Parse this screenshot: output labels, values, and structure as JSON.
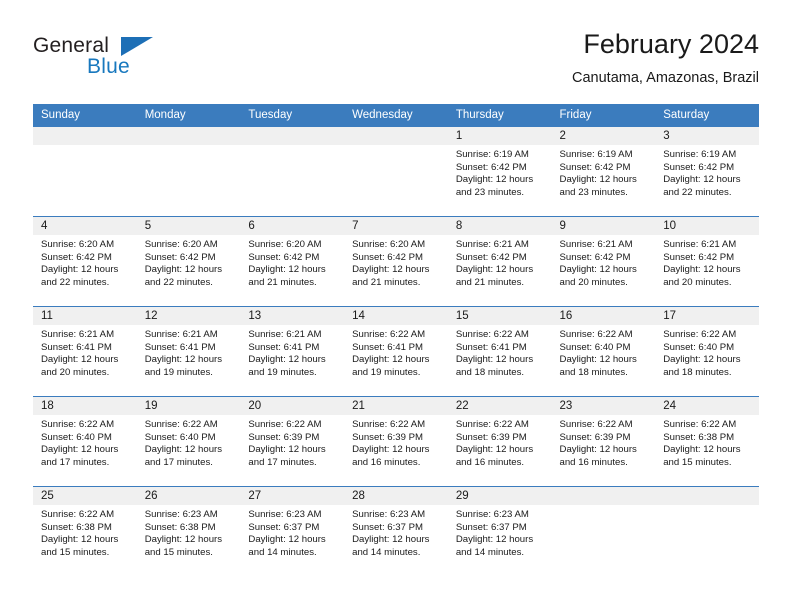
{
  "brand": {
    "name_part1": "General",
    "name_part2": "Blue",
    "triangle_color": "#1d6fb6",
    "blue_color": "#1878be"
  },
  "header": {
    "title": "February 2024",
    "location": "Canutama, Amazonas, Brazil"
  },
  "theme": {
    "header_row_bg": "#3b7cbe",
    "daynum_band_bg": "#f0f0f0",
    "grid_line": "#3b7cbe",
    "text": "#1a1a1a"
  },
  "weekday_headers": [
    "Sunday",
    "Monday",
    "Tuesday",
    "Wednesday",
    "Thursday",
    "Friday",
    "Saturday"
  ],
  "weeks": [
    [
      {
        "day": "",
        "sunrise": "",
        "sunset": "",
        "daylight_line1": "",
        "daylight_line2": ""
      },
      {
        "day": "",
        "sunrise": "",
        "sunset": "",
        "daylight_line1": "",
        "daylight_line2": ""
      },
      {
        "day": "",
        "sunrise": "",
        "sunset": "",
        "daylight_line1": "",
        "daylight_line2": ""
      },
      {
        "day": "",
        "sunrise": "",
        "sunset": "",
        "daylight_line1": "",
        "daylight_line2": ""
      },
      {
        "day": "1",
        "sunrise": "Sunrise: 6:19 AM",
        "sunset": "Sunset: 6:42 PM",
        "daylight_line1": "Daylight: 12 hours",
        "daylight_line2": "and 23 minutes."
      },
      {
        "day": "2",
        "sunrise": "Sunrise: 6:19 AM",
        "sunset": "Sunset: 6:42 PM",
        "daylight_line1": "Daylight: 12 hours",
        "daylight_line2": "and 23 minutes."
      },
      {
        "day": "3",
        "sunrise": "Sunrise: 6:19 AM",
        "sunset": "Sunset: 6:42 PM",
        "daylight_line1": "Daylight: 12 hours",
        "daylight_line2": "and 22 minutes."
      }
    ],
    [
      {
        "day": "4",
        "sunrise": "Sunrise: 6:20 AM",
        "sunset": "Sunset: 6:42 PM",
        "daylight_line1": "Daylight: 12 hours",
        "daylight_line2": "and 22 minutes."
      },
      {
        "day": "5",
        "sunrise": "Sunrise: 6:20 AM",
        "sunset": "Sunset: 6:42 PM",
        "daylight_line1": "Daylight: 12 hours",
        "daylight_line2": "and 22 minutes."
      },
      {
        "day": "6",
        "sunrise": "Sunrise: 6:20 AM",
        "sunset": "Sunset: 6:42 PM",
        "daylight_line1": "Daylight: 12 hours",
        "daylight_line2": "and 21 minutes."
      },
      {
        "day": "7",
        "sunrise": "Sunrise: 6:20 AM",
        "sunset": "Sunset: 6:42 PM",
        "daylight_line1": "Daylight: 12 hours",
        "daylight_line2": "and 21 minutes."
      },
      {
        "day": "8",
        "sunrise": "Sunrise: 6:21 AM",
        "sunset": "Sunset: 6:42 PM",
        "daylight_line1": "Daylight: 12 hours",
        "daylight_line2": "and 21 minutes."
      },
      {
        "day": "9",
        "sunrise": "Sunrise: 6:21 AM",
        "sunset": "Sunset: 6:42 PM",
        "daylight_line1": "Daylight: 12 hours",
        "daylight_line2": "and 20 minutes."
      },
      {
        "day": "10",
        "sunrise": "Sunrise: 6:21 AM",
        "sunset": "Sunset: 6:42 PM",
        "daylight_line1": "Daylight: 12 hours",
        "daylight_line2": "and 20 minutes."
      }
    ],
    [
      {
        "day": "11",
        "sunrise": "Sunrise: 6:21 AM",
        "sunset": "Sunset: 6:41 PM",
        "daylight_line1": "Daylight: 12 hours",
        "daylight_line2": "and 20 minutes."
      },
      {
        "day": "12",
        "sunrise": "Sunrise: 6:21 AM",
        "sunset": "Sunset: 6:41 PM",
        "daylight_line1": "Daylight: 12 hours",
        "daylight_line2": "and 19 minutes."
      },
      {
        "day": "13",
        "sunrise": "Sunrise: 6:21 AM",
        "sunset": "Sunset: 6:41 PM",
        "daylight_line1": "Daylight: 12 hours",
        "daylight_line2": "and 19 minutes."
      },
      {
        "day": "14",
        "sunrise": "Sunrise: 6:22 AM",
        "sunset": "Sunset: 6:41 PM",
        "daylight_line1": "Daylight: 12 hours",
        "daylight_line2": "and 19 minutes."
      },
      {
        "day": "15",
        "sunrise": "Sunrise: 6:22 AM",
        "sunset": "Sunset: 6:41 PM",
        "daylight_line1": "Daylight: 12 hours",
        "daylight_line2": "and 18 minutes."
      },
      {
        "day": "16",
        "sunrise": "Sunrise: 6:22 AM",
        "sunset": "Sunset: 6:40 PM",
        "daylight_line1": "Daylight: 12 hours",
        "daylight_line2": "and 18 minutes."
      },
      {
        "day": "17",
        "sunrise": "Sunrise: 6:22 AM",
        "sunset": "Sunset: 6:40 PM",
        "daylight_line1": "Daylight: 12 hours",
        "daylight_line2": "and 18 minutes."
      }
    ],
    [
      {
        "day": "18",
        "sunrise": "Sunrise: 6:22 AM",
        "sunset": "Sunset: 6:40 PM",
        "daylight_line1": "Daylight: 12 hours",
        "daylight_line2": "and 17 minutes."
      },
      {
        "day": "19",
        "sunrise": "Sunrise: 6:22 AM",
        "sunset": "Sunset: 6:40 PM",
        "daylight_line1": "Daylight: 12 hours",
        "daylight_line2": "and 17 minutes."
      },
      {
        "day": "20",
        "sunrise": "Sunrise: 6:22 AM",
        "sunset": "Sunset: 6:39 PM",
        "daylight_line1": "Daylight: 12 hours",
        "daylight_line2": "and 17 minutes."
      },
      {
        "day": "21",
        "sunrise": "Sunrise: 6:22 AM",
        "sunset": "Sunset: 6:39 PM",
        "daylight_line1": "Daylight: 12 hours",
        "daylight_line2": "and 16 minutes."
      },
      {
        "day": "22",
        "sunrise": "Sunrise: 6:22 AM",
        "sunset": "Sunset: 6:39 PM",
        "daylight_line1": "Daylight: 12 hours",
        "daylight_line2": "and 16 minutes."
      },
      {
        "day": "23",
        "sunrise": "Sunrise: 6:22 AM",
        "sunset": "Sunset: 6:39 PM",
        "daylight_line1": "Daylight: 12 hours",
        "daylight_line2": "and 16 minutes."
      },
      {
        "day": "24",
        "sunrise": "Sunrise: 6:22 AM",
        "sunset": "Sunset: 6:38 PM",
        "daylight_line1": "Daylight: 12 hours",
        "daylight_line2": "and 15 minutes."
      }
    ],
    [
      {
        "day": "25",
        "sunrise": "Sunrise: 6:22 AM",
        "sunset": "Sunset: 6:38 PM",
        "daylight_line1": "Daylight: 12 hours",
        "daylight_line2": "and 15 minutes."
      },
      {
        "day": "26",
        "sunrise": "Sunrise: 6:23 AM",
        "sunset": "Sunset: 6:38 PM",
        "daylight_line1": "Daylight: 12 hours",
        "daylight_line2": "and 15 minutes."
      },
      {
        "day": "27",
        "sunrise": "Sunrise: 6:23 AM",
        "sunset": "Sunset: 6:37 PM",
        "daylight_line1": "Daylight: 12 hours",
        "daylight_line2": "and 14 minutes."
      },
      {
        "day": "28",
        "sunrise": "Sunrise: 6:23 AM",
        "sunset": "Sunset: 6:37 PM",
        "daylight_line1": "Daylight: 12 hours",
        "daylight_line2": "and 14 minutes."
      },
      {
        "day": "29",
        "sunrise": "Sunrise: 6:23 AM",
        "sunset": "Sunset: 6:37 PM",
        "daylight_line1": "Daylight: 12 hours",
        "daylight_line2": "and 14 minutes."
      },
      {
        "day": "",
        "sunrise": "",
        "sunset": "",
        "daylight_line1": "",
        "daylight_line2": ""
      },
      {
        "day": "",
        "sunrise": "",
        "sunset": "",
        "daylight_line1": "",
        "daylight_line2": ""
      }
    ]
  ]
}
